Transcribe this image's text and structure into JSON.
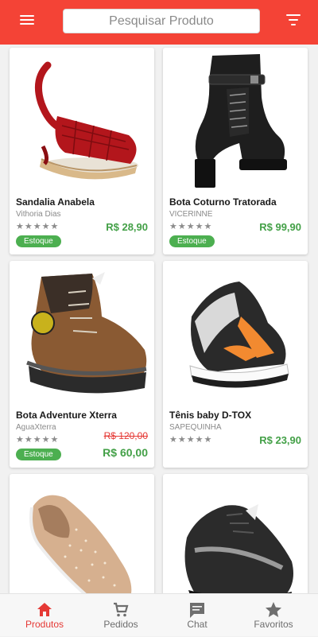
{
  "header": {
    "search_placeholder": "Pesquisar Produto",
    "menu_icon": "hamburger-menu-icon",
    "filter_icon": "filter-icon",
    "bar_color": "#f44336"
  },
  "products": [
    {
      "name": "Sandalia Anabela",
      "vendor": "Vithoria Dias",
      "rating": "★★★★★",
      "price": "R$ 28,90",
      "stock_label": "Estoque"
    },
    {
      "name": "Bota Coturno Tratorada",
      "vendor": "VICERINNE",
      "rating": "★★★★★",
      "price": "R$ 99,90",
      "stock_label": "Estoque"
    },
    {
      "name": "Bota Adventure Xterra",
      "vendor": "AguaXterra",
      "rating": "★★★★★",
      "old_price": "R$ 120,00",
      "price": "R$ 60,00",
      "stock_label": "Estoque"
    },
    {
      "name": "Tênis baby D-TOX",
      "vendor": "SAPEQUINHA",
      "rating": "★★★★★",
      "price": "R$ 23,90"
    },
    {
      "image": "beige-studded-slip-on-sneaker"
    },
    {
      "image": "black-gray-hiking-shoe"
    }
  ],
  "navbar": [
    {
      "label": "Produtos",
      "icon": "home-icon",
      "active": true
    },
    {
      "label": "Pedidos",
      "icon": "cart-icon",
      "active": false
    },
    {
      "label": "Chat",
      "icon": "chat-icon",
      "active": false
    },
    {
      "label": "Favoritos",
      "icon": "star-icon",
      "active": false
    }
  ],
  "colors": {
    "accent": "#f44336",
    "price": "#43a047",
    "old_price": "#e53935",
    "stock_badge": "#4caf50"
  }
}
